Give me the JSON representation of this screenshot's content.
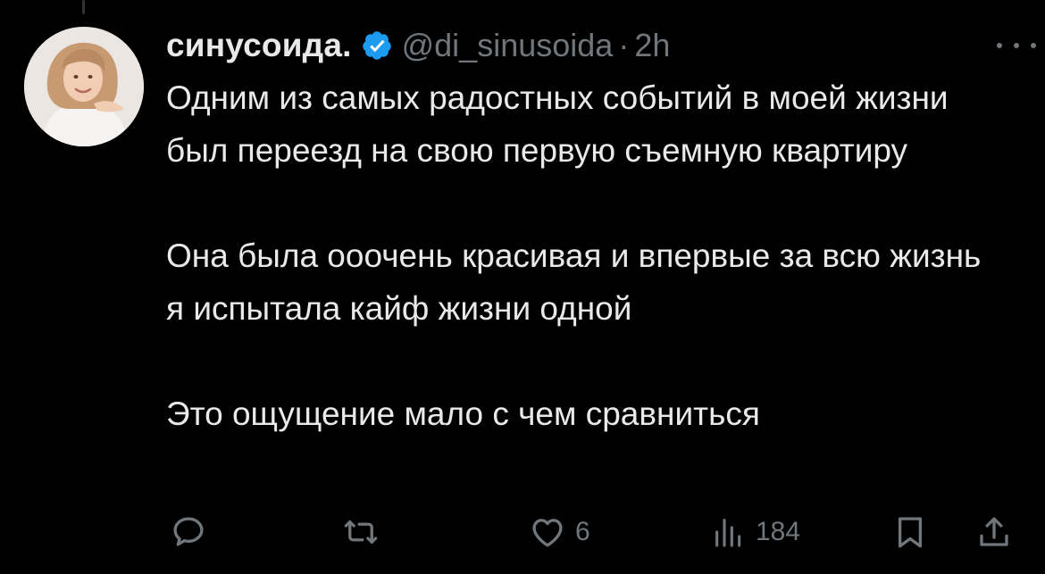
{
  "tweet": {
    "author": {
      "display_name": "синусоида.",
      "handle": "@di_sinusoida",
      "verified": true
    },
    "separator": "·",
    "time": "2h",
    "paragraphs": [
      "Одним из самых радостных событий в моей жизни был переезд на свою первую съемную квартиру",
      "Она была ооочень красивая и впервые за всю жизнь я испытала кайф жизни одной",
      "Это ощущение мало с чем сравниться"
    ],
    "actions": {
      "reply": {
        "icon": "reply-icon",
        "count": ""
      },
      "repost": {
        "icon": "repost-icon",
        "count": ""
      },
      "like": {
        "icon": "heart-icon",
        "count": "6"
      },
      "views": {
        "icon": "views-icon",
        "count": "184"
      },
      "bookmark": {
        "icon": "bookmark-icon",
        "count": ""
      },
      "share": {
        "icon": "share-icon",
        "count": ""
      }
    }
  },
  "colors": {
    "background": "#000000",
    "text_primary": "#e7e9ea",
    "text_secondary": "#71767b",
    "verified_badge": "#1d9bf0"
  }
}
